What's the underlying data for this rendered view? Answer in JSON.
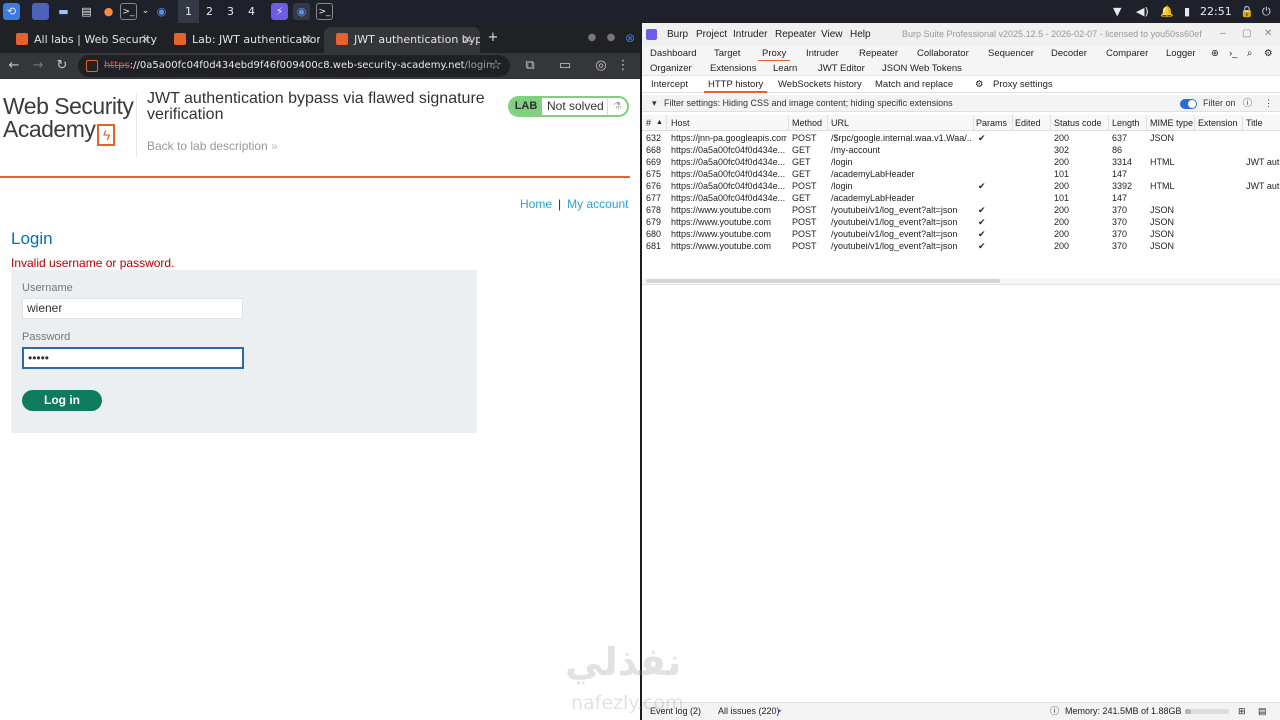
{
  "taskbar": {
    "workspaces": [
      "1",
      "2",
      "3",
      "4"
    ],
    "time": "22:51"
  },
  "browser": {
    "tabs": [
      {
        "label": "All labs | Web Security Ac",
        "close": "✕"
      },
      {
        "label": "Lab: JWT authentication",
        "close": "✕"
      },
      {
        "label": "JWT authentication bypa",
        "close": "✕"
      }
    ],
    "new_tab": "+",
    "url": {
      "scheme": "https",
      "host": "://0a5a00fc04f0d434ebd9f46f009400c8.web-security-academy.net",
      "path": "/login"
    }
  },
  "lab_page": {
    "logo_line1": "Web Security",
    "logo_line2": "Academy",
    "title": "JWT authentication bypass via flawed signature verification",
    "back_link": "Back to lab description",
    "badge_label": "LAB",
    "badge_status": "Not solved",
    "nav_home": "Home",
    "nav_separator": "|",
    "nav_account": "My account",
    "heading": "Login",
    "error": "Invalid username or password.",
    "username_label": "Username",
    "username_value": "wiener",
    "password_label": "Password",
    "password_value": "•••••",
    "login_button": "Log in"
  },
  "burp": {
    "menu": [
      "Burp",
      "Project",
      "Intruder",
      "Repeater",
      "View",
      "Help"
    ],
    "window_title": "Burp Suite Professional v2025.12.5 - 2026-02-07 - licensed to you50ss60ef",
    "tabs_row1": [
      "Dashboard",
      "Target",
      "Proxy",
      "Intruder",
      "Repeater",
      "Collaborator",
      "Sequencer",
      "Decoder",
      "Comparer",
      "Logger"
    ],
    "tabs_row2": [
      "Organizer",
      "Extensions",
      "Learn",
      "JWT Editor",
      "JSON Web Tokens"
    ],
    "active_tab": "Proxy",
    "subtabs": [
      "Intercept",
      "HTTP history",
      "WebSockets history",
      "Match and replace",
      "Proxy settings"
    ],
    "active_subtab": "HTTP history",
    "filter_text": "Filter settings: Hiding CSS and image content; hiding specific extensions",
    "filter_on_label": "Filter on",
    "filter_on": true,
    "columns": [
      "#",
      "Host",
      "Method",
      "URL",
      "Params",
      "Edited",
      "Status code",
      "Length",
      "MIME type",
      "Extension",
      "Title"
    ],
    "rows": [
      {
        "id": "632",
        "host": "https://jnn-pa.googleapis.com",
        "method": "POST",
        "url": "/$rpc/google.internal.waa.v1.Waa/...",
        "params": "✔",
        "status": "200",
        "length": "637",
        "mime": "JSON",
        "title": ""
      },
      {
        "id": "668",
        "host": "https://0a5a00fc04f0d434e...",
        "method": "GET",
        "url": "/my-account",
        "params": "",
        "status": "302",
        "length": "86",
        "mime": "",
        "title": ""
      },
      {
        "id": "669",
        "host": "https://0a5a00fc04f0d434e...",
        "method": "GET",
        "url": "/login",
        "params": "",
        "status": "200",
        "length": "3314",
        "mime": "HTML",
        "title": "JWT auth"
      },
      {
        "id": "675",
        "host": "https://0a5a00fc04f0d434e...",
        "method": "GET",
        "url": "/academyLabHeader",
        "params": "",
        "status": "101",
        "length": "147",
        "mime": "",
        "title": ""
      },
      {
        "id": "676",
        "host": "https://0a5a00fc04f0d434e...",
        "method": "POST",
        "url": "/login",
        "params": "✔",
        "status": "200",
        "length": "3392",
        "mime": "HTML",
        "title": "JWT auth"
      },
      {
        "id": "677",
        "host": "https://0a5a00fc04f0d434e...",
        "method": "GET",
        "url": "/academyLabHeader",
        "params": "",
        "status": "101",
        "length": "147",
        "mime": "",
        "title": ""
      },
      {
        "id": "678",
        "host": "https://www.youtube.com",
        "method": "POST",
        "url": "/youtubei/v1/log_event?alt=json",
        "params": "✔",
        "status": "200",
        "length": "370",
        "mime": "JSON",
        "title": ""
      },
      {
        "id": "679",
        "host": "https://www.youtube.com",
        "method": "POST",
        "url": "/youtubei/v1/log_event?alt=json",
        "params": "✔",
        "status": "200",
        "length": "370",
        "mime": "JSON",
        "title": ""
      },
      {
        "id": "680",
        "host": "https://www.youtube.com",
        "method": "POST",
        "url": "/youtubei/v1/log_event?alt=json",
        "params": "✔",
        "status": "200",
        "length": "370",
        "mime": "JSON",
        "title": ""
      },
      {
        "id": "681",
        "host": "https://www.youtube.com",
        "method": "POST",
        "url": "/youtubei/v1/log_event?alt=json",
        "params": "✔",
        "status": "200",
        "length": "370",
        "mime": "JSON",
        "title": ""
      }
    ],
    "status_bar": {
      "event_log": "Event log (2)",
      "all_issues": "All issues (220)",
      "memory": "Memory: 241.5MB of 1.88GB",
      "memory_fraction": 0.13
    }
  },
  "watermark": {
    "arabic": "نفذلي",
    "latin": "nafezly.com"
  },
  "colors": {
    "burp_accent": "#e8612c",
    "wsa_orange": "#e8612c",
    "login_button": "#0f7b5e",
    "lab_badge": "#7ed17e"
  }
}
